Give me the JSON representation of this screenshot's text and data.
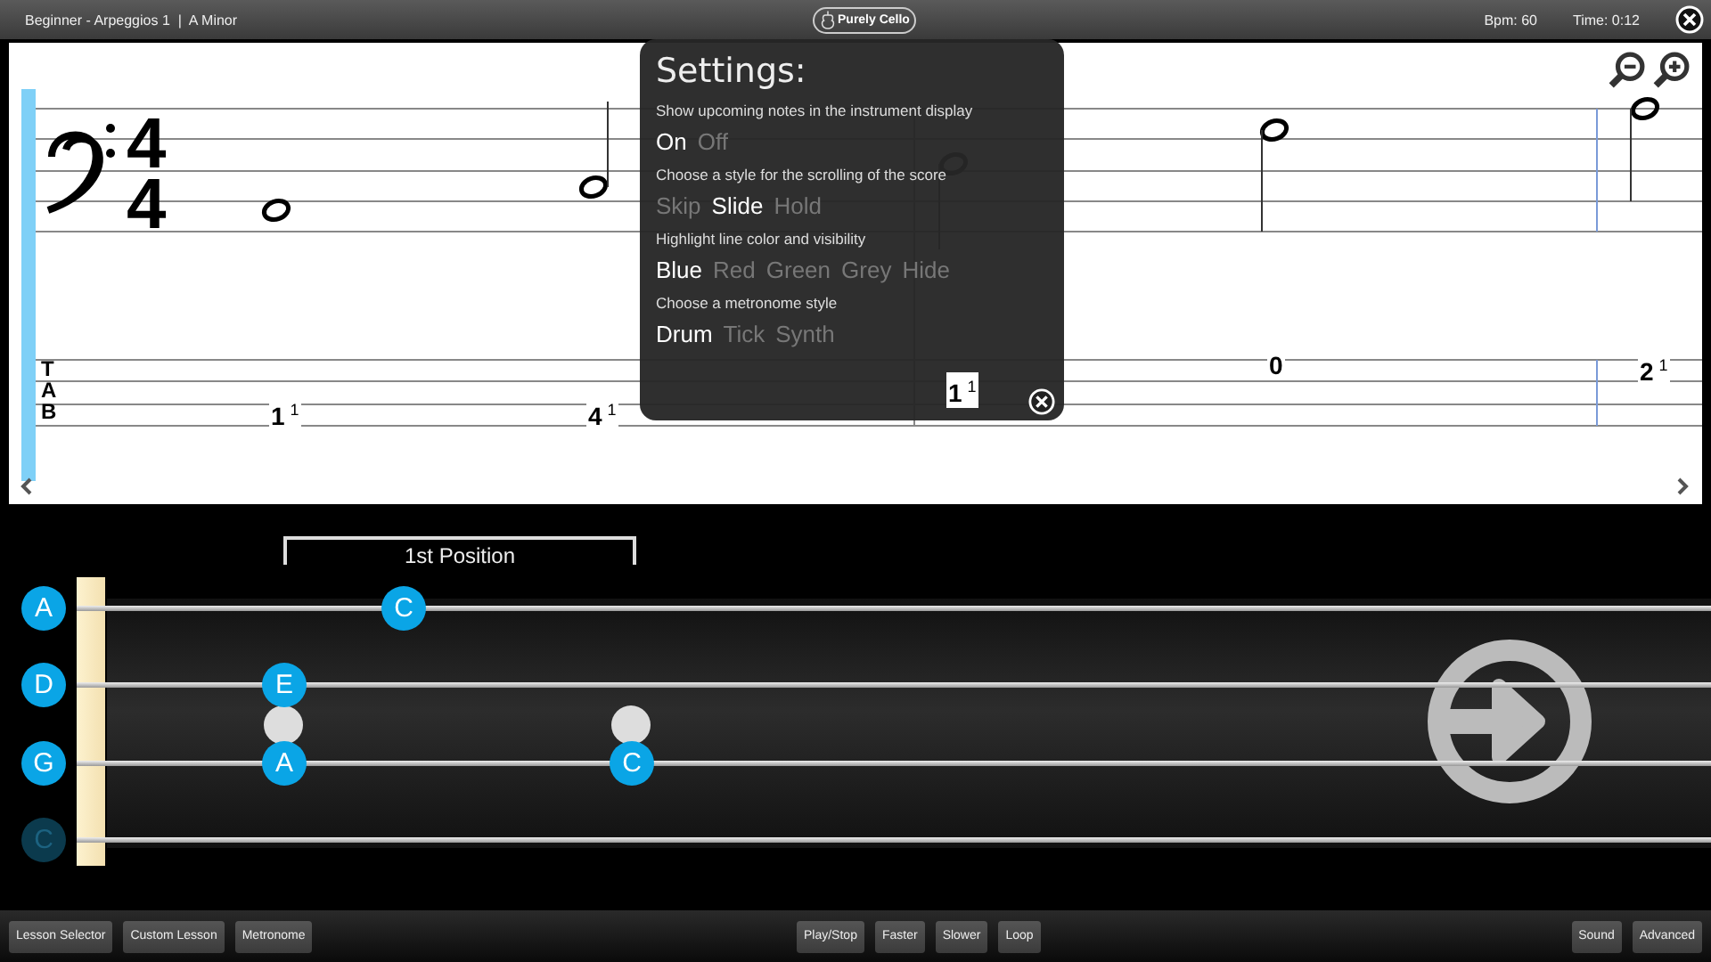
{
  "top_bar": {
    "title": "Beginner - Arpeggios 1  |  A Minor",
    "logo": "Purely Cello",
    "bpm": "Bpm: 60",
    "time": "Time: 0:12"
  },
  "score": {
    "time_signature": [
      "4",
      "4"
    ],
    "tab_letters": [
      "T",
      "A",
      "B"
    ],
    "notes": [
      {
        "tab": "1",
        "finger": "1"
      },
      {
        "tab": "4",
        "finger": "1"
      },
      {
        "tab": "1",
        "finger": "1"
      },
      {
        "tab": "0"
      },
      {
        "tab": "2",
        "finger": "1"
      }
    ]
  },
  "settings": {
    "title": "Settings:",
    "groups": [
      {
        "label": "Show upcoming notes in the instrument display",
        "options": [
          {
            "label": "On",
            "selected": true
          },
          {
            "label": "Off",
            "selected": false
          }
        ]
      },
      {
        "label": "Choose a style for the scrolling of the score",
        "options": [
          {
            "label": "Skip",
            "selected": false
          },
          {
            "label": "Slide",
            "selected": true
          },
          {
            "label": "Hold",
            "selected": false
          }
        ]
      },
      {
        "label": "Highlight line color and visibility",
        "options": [
          {
            "label": "Blue",
            "selected": true
          },
          {
            "label": "Red",
            "selected": false
          },
          {
            "label": "Green",
            "selected": false
          },
          {
            "label": "Grey",
            "selected": false
          },
          {
            "label": "Hide",
            "selected": false
          }
        ]
      },
      {
        "label": "Choose a metronome style",
        "options": [
          {
            "label": "Drum",
            "selected": true
          },
          {
            "label": "Tick",
            "selected": false
          },
          {
            "label": "Synth",
            "selected": false
          }
        ]
      }
    ]
  },
  "fretboard": {
    "position": "1st Position",
    "strings": [
      {
        "label": "A",
        "active": true,
        "notes": [
          {
            "label": "C",
            "upcoming": false
          }
        ]
      },
      {
        "label": "D",
        "active": true,
        "notes": [
          {
            "label": "E",
            "upcoming": false
          }
        ]
      },
      {
        "label": "G",
        "active": true,
        "notes": [
          {
            "label": "A",
            "upcoming": true
          },
          {
            "label": "C",
            "upcoming": true
          }
        ]
      },
      {
        "label": "C",
        "active": false
      }
    ]
  },
  "bottom_bar": {
    "left": [
      "Lesson Selector",
      "Custom Lesson",
      "Metronome"
    ],
    "center": [
      "Play/Stop",
      "Faster",
      "Slower",
      "Loop"
    ],
    "right": [
      "Sound",
      "Advanced"
    ]
  }
}
